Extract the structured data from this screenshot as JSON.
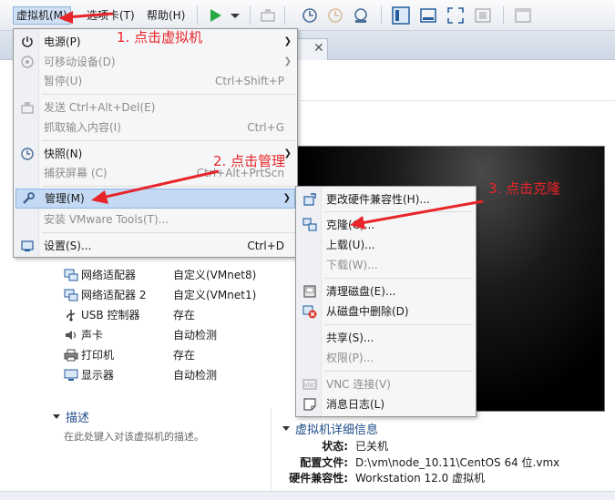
{
  "toolbar": {
    "menus": [
      {
        "label": "虚拟机(M)"
      },
      {
        "label": "选项卡(T)"
      },
      {
        "label": "帮助(H)"
      }
    ]
  },
  "vm_menu": {
    "items": [
      {
        "label": "电源(P)",
        "shortcut": "",
        "icon": "power-icon"
      },
      {
        "label": "可移动设备(D)",
        "shortcut": "",
        "icon": "removable-device-icon"
      },
      {
        "label": "暂停(U)",
        "shortcut": "Ctrl+Shift+P",
        "icon": ""
      },
      {
        "label": "发送 Ctrl+Alt+Del(E)",
        "shortcut": "",
        "icon": "send-keys-icon"
      },
      {
        "label": "抓取输入内容(I)",
        "shortcut": "Ctrl+G",
        "icon": ""
      },
      {
        "label": "快照(N)",
        "shortcut": "",
        "icon": "snapshot-icon"
      },
      {
        "label": "捕获屏幕 (C)",
        "shortcut": "Ctrl+Alt+PrtScn",
        "icon": ""
      },
      {
        "label": "管理(M)",
        "shortcut": "",
        "icon": "wrench-icon"
      },
      {
        "label": "安装 VMware Tools(T)...",
        "shortcut": "",
        "icon": ""
      },
      {
        "label": "设置(S)...",
        "shortcut": "Ctrl+D",
        "icon": "settings-icon"
      }
    ]
  },
  "manage_menu": {
    "items": [
      {
        "label": "更改硬件兼容性(H)...",
        "icon": "hardware-compat-icon"
      },
      {
        "label": "克隆(C)...",
        "icon": "clone-icon"
      },
      {
        "label": "上载(U)...",
        "icon": ""
      },
      {
        "label": "下载(W)...",
        "icon": ""
      },
      {
        "label": "清理磁盘(E)...",
        "icon": "disk-cleanup-icon"
      },
      {
        "label": "从磁盘中删除(D)",
        "icon": "delete-icon"
      },
      {
        "label": "共享(S)...",
        "icon": ""
      },
      {
        "label": "权限(P)...",
        "icon": ""
      },
      {
        "label": "VNC 连接(V)",
        "icon": "vnc-icon"
      },
      {
        "label": "消息日志(L)",
        "icon": "message-log-icon"
      }
    ]
  },
  "devices": [
    {
      "name": "网络适配器",
      "value": "自定义(VMnet8)",
      "icon": "network-adapter-icon"
    },
    {
      "name": "网络适配器 2",
      "value": "自定义(VMnet1)",
      "icon": "network-adapter-icon"
    },
    {
      "name": "USB 控制器",
      "value": "存在",
      "icon": "usb-icon"
    },
    {
      "name": "声卡",
      "value": "自动检测",
      "icon": "sound-icon"
    },
    {
      "name": "打印机",
      "value": "存在",
      "icon": "printer-icon"
    },
    {
      "name": "显示器",
      "value": "自动检测",
      "icon": "display-icon"
    }
  ],
  "description": {
    "title": "描述",
    "placeholder": "在此处键入对该虚拟机的描述。"
  },
  "details": {
    "title": "虚拟机详细信息",
    "rows": [
      {
        "label": "状态:",
        "value": "已关机"
      },
      {
        "label": "配置文件:",
        "value": "D:\\vm\\node_10.11\\CentOS 64 位.vmx"
      },
      {
        "label": "硬件兼容性:",
        "value": "Workstation 12.0 虚拟机"
      }
    ]
  },
  "annotations": [
    {
      "text": "1.  点击虚拟机"
    },
    {
      "text": "2.  点击管理"
    },
    {
      "text": "3.  点击克隆"
    }
  ],
  "colors": {
    "annotation_red": "#e8252a",
    "highlight": "#c4daf4"
  }
}
